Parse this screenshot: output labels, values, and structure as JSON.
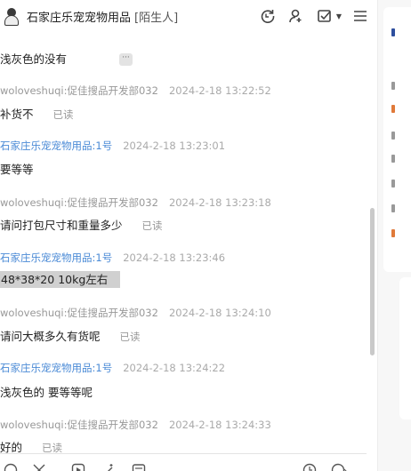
{
  "header": {
    "title": "石家庄乐宠宠物用品",
    "tag": "[陌生人]",
    "icons": [
      "refresh-icon",
      "add-contact-icon",
      "task-check-icon",
      "menu-icon"
    ]
  },
  "messages": [
    {
      "sender": "woloveshuqi:促佳搜品开发部032",
      "time": "2024-2-18 13:22:52",
      "text": "补货不",
      "read": "已读",
      "role": "self"
    },
    {
      "sender": "石家庄乐宠宠物用品:1号",
      "time": "2024-2-18 13:23:01",
      "text": "要等等",
      "read": "",
      "role": "peer"
    },
    {
      "sender": "woloveshuqi:促佳搜品开发部032",
      "time": "2024-2-18 13:23:18",
      "text": "请问打包尺寸和重量多少",
      "read": "已读",
      "role": "self"
    },
    {
      "sender": "石家庄乐宠宠物用品:1号",
      "time": "2024-2-18 13:23:46",
      "text": "48*38*20   10kg左右",
      "read": "",
      "role": "peer"
    },
    {
      "sender": "woloveshuqi:促佳搜品开发部032",
      "time": "2024-2-18 13:24:10",
      "text": "请问大概多久有货呢",
      "read": "已读",
      "role": "self"
    },
    {
      "sender": "石家庄乐宠宠物用品:1号",
      "time": "2024-2-18 13:24:22",
      "text": "浅灰色的 要等等呢",
      "read": "",
      "role": "peer"
    },
    {
      "sender": "woloveshuqi:促佳搜品开发部032",
      "time": "2024-2-18 13:24:33",
      "text": "好的",
      "read": "已读",
      "role": "self"
    }
  ],
  "partial_top": {
    "text": "浅灰色的没有",
    "more_label": "···"
  },
  "colors": {
    "peer_sender": "#4a8ad6",
    "meta": "#999999",
    "highlight": "#d0d0d0"
  }
}
